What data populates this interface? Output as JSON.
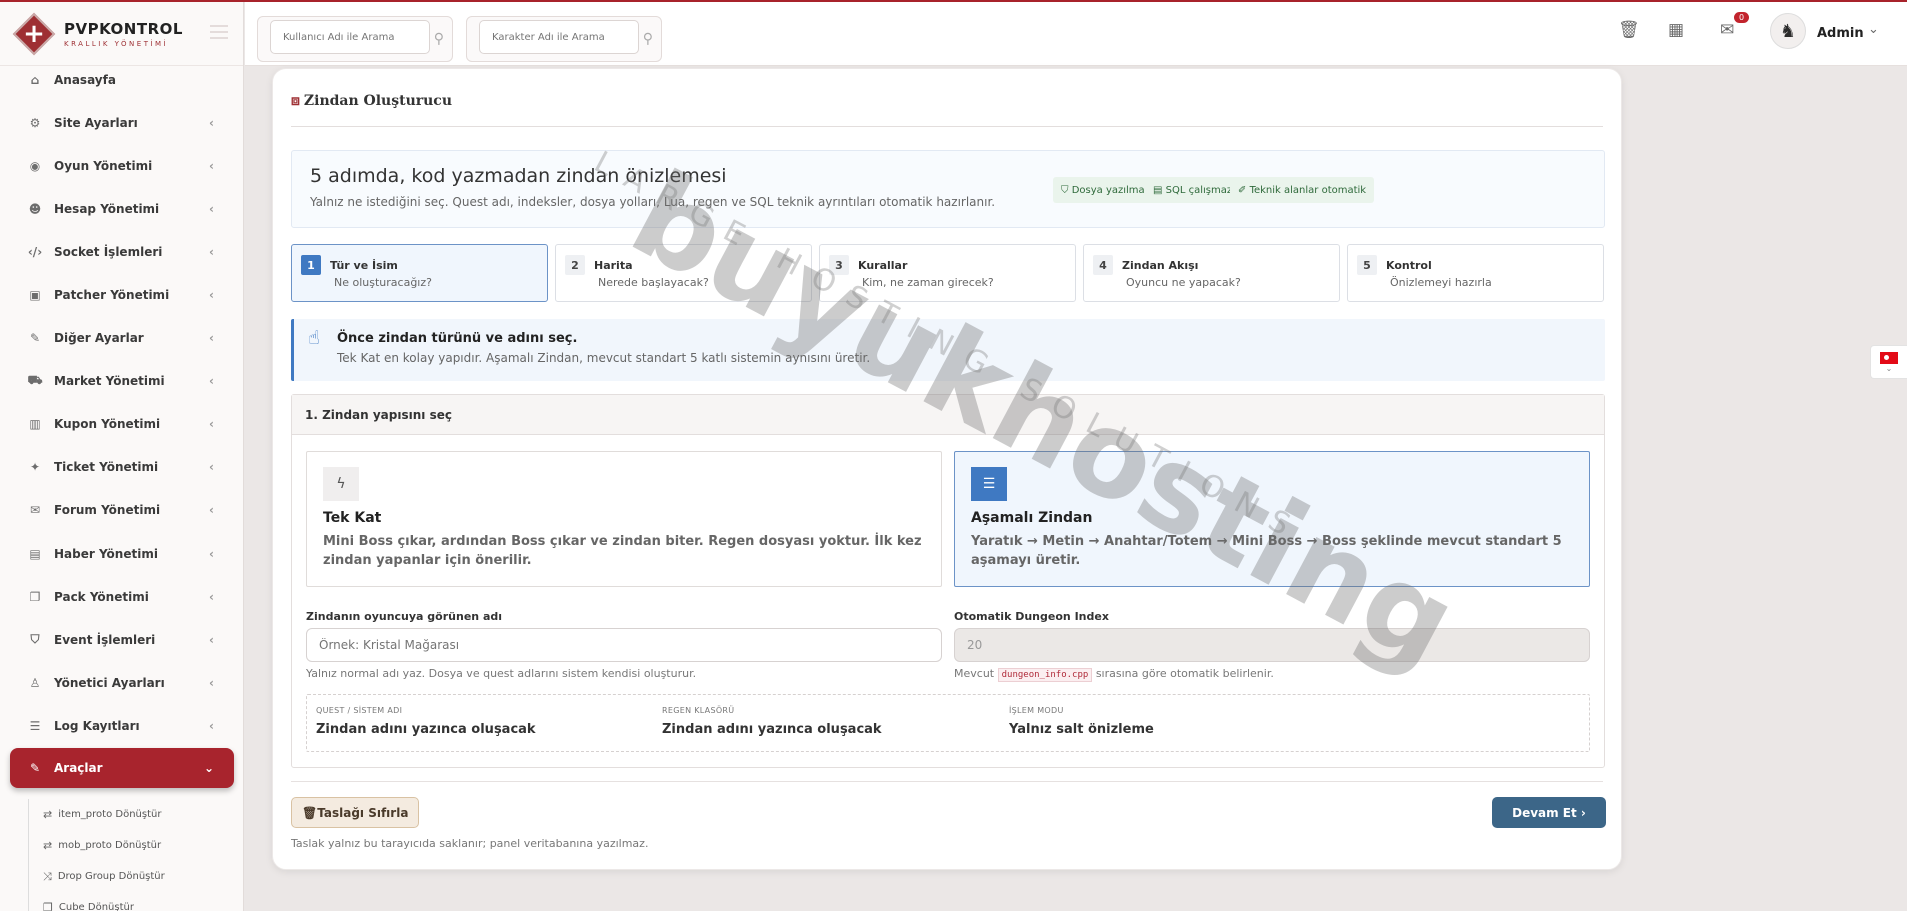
{
  "brand": {
    "title": "PVPKONTROL",
    "subtitle": "KRALLIK YÖNETİMİ"
  },
  "search": {
    "user_placeholder": "Kullanıcı Adı ile Arama",
    "char_placeholder": "Karakter Adı ile Arama"
  },
  "topbar": {
    "notification_count": "0",
    "user_name": "Admin"
  },
  "sidebar": {
    "items": [
      {
        "label": "Anasayfa",
        "icon": "home-icon"
      },
      {
        "label": "Site Ayarları",
        "icon": "gear-icon"
      },
      {
        "label": "Oyun Yönetimi",
        "icon": "gamepad-icon"
      },
      {
        "label": "Hesap Yönetimi",
        "icon": "users-icon"
      },
      {
        "label": "Socket İşlemleri",
        "icon": "code-icon"
      },
      {
        "label": "Patcher Yönetimi",
        "icon": "box-icon"
      },
      {
        "label": "Diğer Ayarlar",
        "icon": "wrench-icon"
      },
      {
        "label": "Market Yönetimi",
        "icon": "cart-icon"
      },
      {
        "label": "Kupon Yönetimi",
        "icon": "barcode-icon"
      },
      {
        "label": "Ticket Yönetimi",
        "icon": "ticket-icon"
      },
      {
        "label": "Forum Yönetimi",
        "icon": "comments-icon"
      },
      {
        "label": "Haber Yönetimi",
        "icon": "newspaper-icon"
      },
      {
        "label": "Pack Yönetimi",
        "icon": "copy-icon"
      },
      {
        "label": "Event İşlemleri",
        "icon": "shield-icon"
      },
      {
        "label": "Yönetici Ayarları",
        "icon": "user-tie-icon"
      },
      {
        "label": "Log Kayıtları",
        "icon": "list-icon"
      },
      {
        "label": "Araçlar",
        "icon": "tools-icon"
      }
    ],
    "sub_items": [
      {
        "label": "item_proto Dönüştür"
      },
      {
        "label": "mob_proto Dönüştür"
      },
      {
        "label": "Drop Group Dönüştür"
      },
      {
        "label": "Cube Dönüştür"
      }
    ]
  },
  "page": {
    "title": "Zindan Oluşturucu",
    "intro_heading": "5 adımda, kod yazmadan zindan önizlemesi",
    "intro_text": "Yalnız ne istediğini seç. Quest adı, indeksler, dosya yolları, Lua, regen ve SQL teknik ayrıntıları otomatik hazırlanır.",
    "pills": [
      "Dosya yazılmaz",
      "SQL çalışmaz",
      "Teknik alanlar otomatik"
    ],
    "steps": [
      {
        "num": "1",
        "title": "Tür ve İsim",
        "desc": "Ne oluşturacağız?"
      },
      {
        "num": "2",
        "title": "Harita",
        "desc": "Nerede başlayacak?"
      },
      {
        "num": "3",
        "title": "Kurallar",
        "desc": "Kim, ne zaman girecek?"
      },
      {
        "num": "4",
        "title": "Zindan Akışı",
        "desc": "Oyuncu ne yapacak?"
      },
      {
        "num": "5",
        "title": "Kontrol",
        "desc": "Önizlemeyi hazırla"
      }
    ],
    "hint_title": "Önce zindan türünü ve adını seç.",
    "hint_text": "Tek Kat en kolay yapıdır. Aşamalı Zindan, mevcut standart 5 katlı sistemin aynısını üretir.",
    "section_title": "1. Zindan yapısını seç",
    "options": [
      {
        "title": "Tek Kat",
        "desc": "Mini Boss çıkar, ardından Boss çıkar ve zindan biter. Regen dosyası yoktur. İlk kez zindan yapanlar için önerilir."
      },
      {
        "title": "Aşamalı Zindan",
        "desc": "Yaratık → Metin → Anahtar/Totem → Mini Boss → Boss şeklinde mevcut standart 5 aşamayı üretir."
      }
    ],
    "name_label": "Zindanın oyuncuya görünen adı",
    "name_placeholder": "Örnek: Kristal Mağarası",
    "name_help": "Yalnız normal adı yaz. Dosya ve quest adlarını sistem kendisi oluşturur.",
    "index_label": "Otomatik Dungeon Index",
    "index_value": "20",
    "index_help_pre": "Mevcut",
    "index_help_code": "dungeon_info.cpp",
    "index_help_post": "sırasına göre otomatik belirlenir.",
    "meta": [
      {
        "label": "QUEST / SİSTEM ADI",
        "value": "Zindan adını yazınca oluşacak"
      },
      {
        "label": "REGEN KLASÖRÜ",
        "value": "Zindan adını yazınca oluşacak"
      },
      {
        "label": "İŞLEM MODU",
        "value": "Yalnız salt önizleme"
      }
    ],
    "reset_label": "Taslağı Sıfırla",
    "next_label": "Devam Et",
    "draft_note": "Taslak yalnız bu tarayıcıda saklanır; panel veritabanına yazılmaz."
  },
  "watermark": {
    "main": "buyukhosting",
    "sub": "LARGE HOSTING SOLUTIONS"
  },
  "colors": {
    "accent": "#a8242d",
    "primary": "#3f79c2",
    "button": "#3c6688"
  }
}
